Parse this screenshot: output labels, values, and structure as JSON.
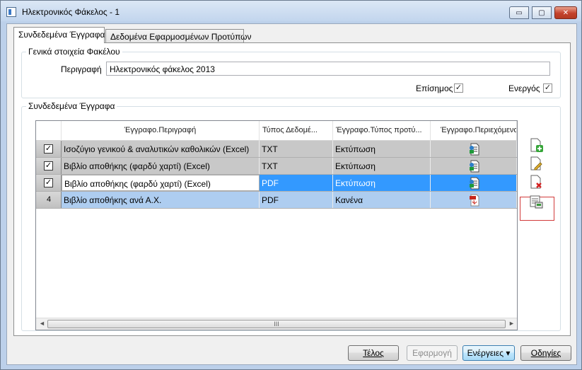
{
  "window": {
    "title": "Ηλεκτρονικός Φάκελος - 1",
    "min_glyph": "▭",
    "max_glyph": "▢",
    "close_glyph": "✕"
  },
  "tabs": [
    {
      "label": "Συνδεδεμένα Έγγραφα",
      "active": true
    },
    {
      "label": "Δεδομένα Εφαρμοσμένων Προτύπων",
      "active": false
    }
  ],
  "general": {
    "group_title": "Γενικά στοιχεία Φακέλου",
    "description_label": "Περιγραφή",
    "description_value": "Ηλεκτρονικός φάκελος 2013",
    "official_label": "Επίσημος",
    "official_checked": true,
    "active_label": "Ενεργός",
    "active_checked": true
  },
  "documents": {
    "group_title": "Συνδεδεμένα Έγγραφα",
    "columns": [
      "Έγγραφο.Περιγραφή",
      "Τύπος Δεδομέ...",
      "Έγγραφο.Τύπος προτύ...",
      "Έγγραφο.Περιεχόμενο"
    ],
    "rows": [
      {
        "indicator": "check",
        "description": "Ισοζύγιο γενικού & αναλυτικών καθολικών (Excel)",
        "type": "TXT",
        "template": "Εκτύπωση",
        "content_icon": "text-document-icon"
      },
      {
        "indicator": "check",
        "description": "Βιβλίο αποθήκης (φαρδύ χαρτί) (Excel)",
        "type": "TXT",
        "template": "Εκτύπωση",
        "content_icon": "text-document-icon"
      },
      {
        "indicator": "check",
        "description": "Βιβλίο αποθήκης (φαρδύ χαρτί) (Excel)",
        "type": "PDF",
        "template": "Εκτύπωση",
        "content_icon": "text-document-icon",
        "selected": true
      },
      {
        "indicator": "4",
        "description": "Βιβλίο αποθήκης ανά Α.Χ.",
        "type": "PDF",
        "template": "Κανένα",
        "content_icon": "pdf-document-icon",
        "hover": true
      }
    ],
    "check_glyph": "✓",
    "scroll_left": "◄",
    "scroll_right": "►",
    "scroll_grip": "III"
  },
  "side_buttons": [
    "add-document-icon",
    "edit-document-icon",
    "delete-document-icon",
    "view-document-icon"
  ],
  "footer": {
    "finish_label": "Τέλος",
    "apply_label": "Εφαρμογή",
    "actions_label": "Ενέργειες ▾",
    "help_label": "Οδηγίες"
  }
}
